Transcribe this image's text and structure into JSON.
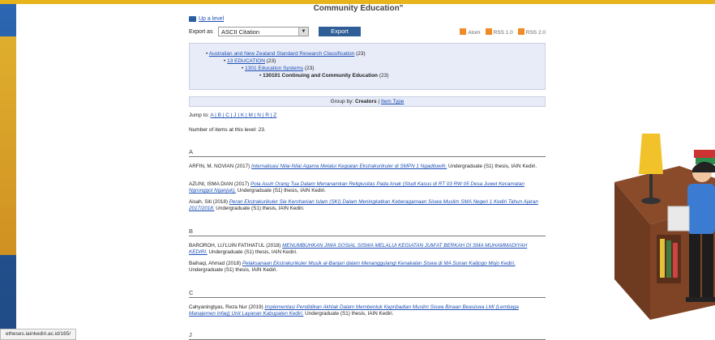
{
  "page": {
    "title": "Community Education\"",
    "up_level": "Up a level",
    "export_label": "Export as",
    "export_format": "ASCII Citation",
    "export_button": "Export",
    "feeds": [
      "Atom",
      "RSS 1.0",
      "RSS 2.0"
    ]
  },
  "subjects": {
    "l1": "Australian and New Zealand Standard Research Classification",
    "l1_count": "(23)",
    "l2": "13 EDUCATION",
    "l2_count": "(23)",
    "l3": "1301 Education Systems",
    "l3_count": "(23)",
    "l4": "130101 Continuing and Community Education",
    "l4_count": "(23)"
  },
  "groupby": {
    "label": "Group by:",
    "active": "Creators",
    "sep": "|",
    "other": "Item Type"
  },
  "jump": {
    "label": "Jump to:",
    "letters": "A | B | C | J | K | M | N | R | Z"
  },
  "count_text": "Number of items at this level: 23.",
  "sections": [
    {
      "letter": "A",
      "entries": [
        {
          "author": "ARFIN, M. NOVIAN (2017)",
          "title": "Internalisasi Nilai-Nilai Agama Melalui Kegiatan Ekstrakurikuler di SMPN 1 Ngadiluwih.",
          "tail": "Undergraduate (S1) thesis, IAIN Kediri."
        },
        {
          "author": "AZUNI, ISMA DIAN (2017)",
          "title": "Pola Asuh Orang Tua Dalam Menanamkan Religiusitas Pada Anak (Studi Kasus di RT 03 RW 05 Desa Juwet Kecamatan Ngronggot Nganjuk).",
          "tail": "Undergraduate (S1) thesis, IAIN Kediri."
        },
        {
          "author": "Aisah, Siti (2018)",
          "title": "Peran Ekstrakurikuler Sie Kerohanian Islam (SKI) Dalam Meningkatkan Keberagamaan Siswa Muslim SMA Negeri 1 Kediri Tahun Ajaran 2017/2018.",
          "tail": "Undergraduate (S1) thesis, IAIN Kediri."
        }
      ]
    },
    {
      "letter": "B",
      "entries": [
        {
          "author": "BAROROH, LU'LUIN FATIHATUL (2018)",
          "title": "MENUMBUHKAN JIWA SOSIAL SISWA MELALUI KEGIATAN JUM'AT BERKAH DI SMA MUHAMMADIYAH KEDIRI.",
          "tail": "Undergraduate (S1) thesis, IAIN Kediri."
        },
        {
          "author": "Baihaqi, Ahmad (2018)",
          "title": "Pelaksanaan Ekstrakurikuler Musik al-Banjari dalam Menanggulangi Kenakalan Siswa di MA Sunan Kalijogo Mojo Kediri.",
          "tail": "Undergraduate (S1) thesis, IAIN Kediri."
        }
      ]
    },
    {
      "letter": "C",
      "entries": [
        {
          "author": "Cahyaningtyas, Reza Nur (2019)",
          "title": "Implementasi Pendidikan Akhlak Dalam Membentuk Kepribadian Muslim Siswa Binaan Beasiswa LMI (Lembaga Manajemen Infaq) Unit Layanan Kabupaten Kediri.",
          "tail": "Undergraduate (S1) thesis, IAIN Kediri."
        }
      ]
    },
    {
      "letter": "J",
      "entries": []
    }
  ],
  "status_url": "etheses.iainkediri.ac.id/165/",
  "colors": {
    "frame": "#e8b41c",
    "background": "#2a5ea2",
    "link": "#1d4fb5",
    "panel": "#e8ecf8",
    "button": "#2f5e96"
  }
}
